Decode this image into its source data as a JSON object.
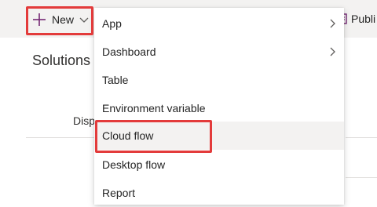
{
  "toolbar": {
    "new_label": "New",
    "publish_label": "Publi"
  },
  "content": {
    "title": "Solutions",
    "column_label": "Disp"
  },
  "menu": {
    "items": [
      {
        "label": "App",
        "has_submenu": true
      },
      {
        "label": "Dashboard",
        "has_submenu": true
      },
      {
        "label": "Table",
        "has_submenu": false
      },
      {
        "label": "Environment variable",
        "has_submenu": false
      },
      {
        "label": "Cloud flow",
        "has_submenu": false,
        "selected": true
      },
      {
        "label": "Desktop flow",
        "has_submenu": false
      },
      {
        "label": "Report",
        "has_submenu": false
      }
    ]
  },
  "colors": {
    "accent_purple": "#742774",
    "highlight_red": "#e33b3b",
    "toolbar_bg": "#f3f2f1"
  }
}
